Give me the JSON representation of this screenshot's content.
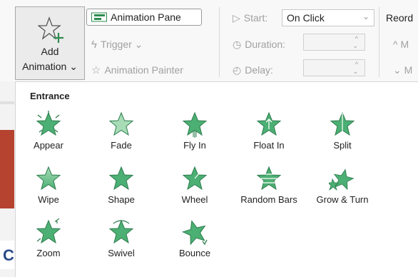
{
  "ribbon": {
    "add_animation": {
      "line1": "Add",
      "line2": "Animation ⌄"
    },
    "animation_pane": "Animation Pane",
    "trigger": "Trigger ⌄",
    "animation_painter": "Animation Painter",
    "start_label": "Start:",
    "start_value": "On Click",
    "duration_label": "Duration:",
    "delay_label": "Delay:",
    "reorder_label": "Reord",
    "reorder_up": "^ M",
    "reorder_down": "⌄ M"
  },
  "gallery": {
    "section_title": "Entrance",
    "items": [
      {
        "label": "Appear",
        "icon": "star-burst-icon"
      },
      {
        "label": "Fade",
        "icon": "star-fade-icon"
      },
      {
        "label": "Fly In",
        "icon": "star-flyin-icon"
      },
      {
        "label": "Float In",
        "icon": "star-floatin-icon"
      },
      {
        "label": "Split",
        "icon": "star-split-icon"
      },
      {
        "label": "Wipe",
        "icon": "star-wipe-icon"
      },
      {
        "label": "Shape",
        "icon": "star-shape-icon"
      },
      {
        "label": "Wheel",
        "icon": "star-wheel-icon"
      },
      {
        "label": "Random Bars",
        "icon": "star-randombars-icon"
      },
      {
        "label": "Grow & Turn",
        "icon": "star-growturn-icon"
      },
      {
        "label": "Zoom",
        "icon": "star-zoom-icon"
      },
      {
        "label": "Swivel",
        "icon": "star-swivel-icon"
      },
      {
        "label": "Bounce",
        "icon": "star-bounce-icon"
      }
    ]
  },
  "colors": {
    "star_fill": "#4caf73",
    "star_light": "#a8dcb6",
    "star_stroke": "#2e7d4f",
    "accent_left": "#c0392b"
  }
}
